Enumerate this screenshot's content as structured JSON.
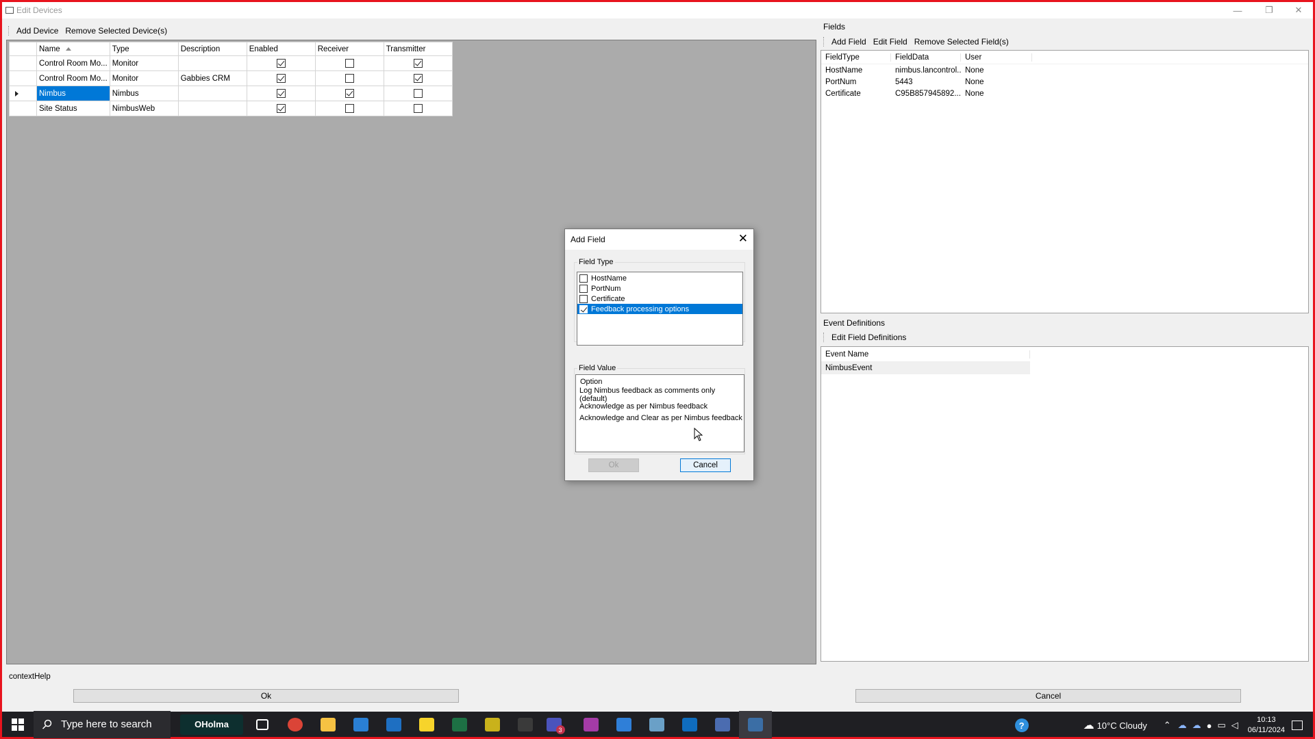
{
  "window": {
    "title": "Edit Devices",
    "minimize": "—",
    "maximize": "❐",
    "close": "✕"
  },
  "devices_toolbar": {
    "add_device": "Add Device",
    "remove_device": "Remove Selected Device(s)"
  },
  "devices_table": {
    "columns": [
      "Name",
      "Type",
      "Description",
      "Enabled",
      "Receiver",
      "Transmitter"
    ],
    "rows": [
      {
        "name": "Control Room Mo...",
        "type": "Monitor",
        "description": "",
        "enabled": true,
        "receiver": false,
        "transmitter": true
      },
      {
        "name": "Control Room Mo...",
        "type": "Monitor",
        "description": "Gabbies CRM",
        "enabled": true,
        "receiver": false,
        "transmitter": true
      },
      {
        "name": "Nimbus",
        "type": "Nimbus",
        "description": "",
        "enabled": true,
        "receiver": true,
        "transmitter": false
      },
      {
        "name": "Site Status",
        "type": "NimbusWeb",
        "description": "",
        "enabled": true,
        "receiver": false,
        "transmitter": false
      }
    ]
  },
  "fields": {
    "group_label": "Fields",
    "toolbar": {
      "add_field": "Add Field",
      "edit_field": "Edit Field",
      "remove_fields": "Remove Selected Field(s)"
    },
    "columns": [
      "FieldType",
      "FieldData",
      "User"
    ],
    "rows": [
      {
        "type": "HostName",
        "data": "nimbus.lancontrol...",
        "user": "None"
      },
      {
        "type": "PortNum",
        "data": "5443",
        "user": "None"
      },
      {
        "type": "Certificate",
        "data": "C95B857945892...",
        "user": "None"
      }
    ]
  },
  "events": {
    "group_label": "Event Definitions",
    "toolbar": {
      "edit_defs": "Edit Field Definitions"
    },
    "column": "Event Name",
    "rows": [
      "NimbusEvent"
    ]
  },
  "context_help": "contextHelp",
  "bottom": {
    "ok": "Ok",
    "cancel": "Cancel"
  },
  "dialog": {
    "title": "Add Field",
    "close": "✕",
    "field_type_label": "Field Type",
    "field_types": [
      {
        "label": "HostName",
        "checked": false,
        "selected": false
      },
      {
        "label": "PortNum",
        "checked": false,
        "selected": false
      },
      {
        "label": "Certificate",
        "checked": false,
        "selected": false
      },
      {
        "label": "Feedback processing options",
        "checked": true,
        "selected": true
      }
    ],
    "field_value_label": "Field Value",
    "value_header": "Option",
    "values": [
      "Log Nimbus feedback as comments only (default)",
      "Acknowledge as per Nimbus feedback",
      "Acknowledge and Clear as per Nimbus feedback"
    ],
    "ok": "Ok",
    "cancel": "Cancel"
  },
  "taskbar": {
    "search_placeholder": "Type here to search",
    "holma": "OHolma",
    "weather": "10°C  Cloudy",
    "time": "10:13",
    "date": "06/11/2024",
    "teams_badge": "3",
    "apps": [
      {
        "name": "task-view-icon",
        "color": "#1f1f23"
      },
      {
        "name": "chrome-icon",
        "color": "#db4437"
      },
      {
        "name": "file-explorer-icon",
        "color": "#f6c243"
      },
      {
        "name": "store-icon",
        "color": "#2a7fd4"
      },
      {
        "name": "app-blue-icon",
        "color": "#1e6fc2"
      },
      {
        "name": "sticky-notes-icon",
        "color": "#f7d42b"
      },
      {
        "name": "excel-icon",
        "color": "#1d7044"
      },
      {
        "name": "app-yellow-icon",
        "color": "#c9b21b"
      },
      {
        "name": "cx-icon",
        "color": "#3a3a3a"
      },
      {
        "name": "teams-icon",
        "color": "#4b53bc"
      },
      {
        "name": "le-icon",
        "color": "#a43ba6"
      },
      {
        "name": "app-window-icon",
        "color": "#2f7fd8"
      },
      {
        "name": "app-pen-icon",
        "color": "#6aa0c7"
      },
      {
        "name": "outlook-icon",
        "color": "#0f6cbd"
      },
      {
        "name": "app-inbox-icon",
        "color": "#4b6cb0"
      },
      {
        "name": "remote-desktop-icon",
        "color": "#3b6ea5"
      }
    ]
  }
}
